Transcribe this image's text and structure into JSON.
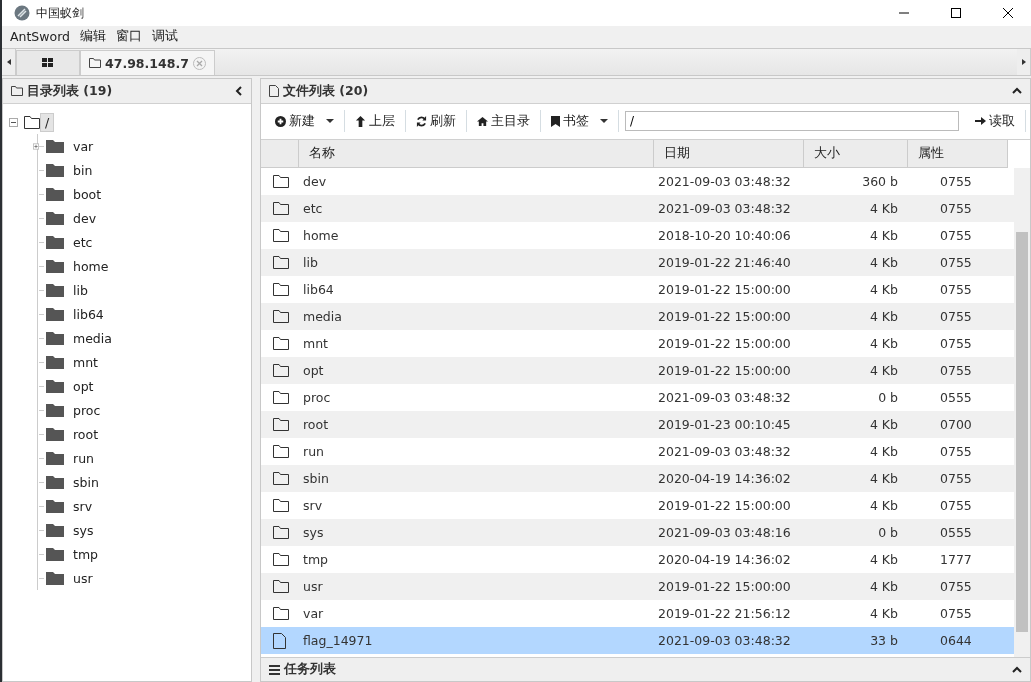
{
  "window": {
    "title": "中国蚁剑"
  },
  "menu": [
    "AntSword",
    "编辑",
    "窗口",
    "调试"
  ],
  "tabs": [
    {
      "kind": "grid",
      "selected": false
    },
    {
      "kind": "folder",
      "label": "47.98.148.7",
      "selected": true
    }
  ],
  "dir_panel": {
    "title": "目录列表 (19)",
    "tree": {
      "name": "/",
      "selected": true,
      "expanded": true,
      "children": [
        {
          "name": "var",
          "expandable": true
        },
        {
          "name": "bin",
          "expandable": false
        },
        {
          "name": "boot",
          "expandable": false
        },
        {
          "name": "dev",
          "expandable": false
        },
        {
          "name": "etc",
          "expandable": false
        },
        {
          "name": "home",
          "expandable": false
        },
        {
          "name": "lib",
          "expandable": false
        },
        {
          "name": "lib64",
          "expandable": false
        },
        {
          "name": "media",
          "expandable": false
        },
        {
          "name": "mnt",
          "expandable": false
        },
        {
          "name": "opt",
          "expandable": false
        },
        {
          "name": "proc",
          "expandable": false
        },
        {
          "name": "root",
          "expandable": false
        },
        {
          "name": "run",
          "expandable": false
        },
        {
          "name": "sbin",
          "expandable": false
        },
        {
          "name": "srv",
          "expandable": false
        },
        {
          "name": "sys",
          "expandable": false
        },
        {
          "name": "tmp",
          "expandable": false
        },
        {
          "name": "usr",
          "expandable": false
        }
      ]
    }
  },
  "file_panel": {
    "title": "文件列表 (20)",
    "toolbar": [
      {
        "kind": "new",
        "label": "新建",
        "dropdown": true
      },
      {
        "kind": "up",
        "label": "上层",
        "dropdown": false
      },
      {
        "kind": "refresh",
        "label": "刷新",
        "dropdown": false
      },
      {
        "kind": "home",
        "label": "主目录",
        "dropdown": false
      },
      {
        "kind": "bookmark",
        "label": "书签",
        "dropdown": true
      }
    ],
    "path": "/",
    "read_button": "读取",
    "columns": [
      "名称",
      "日期",
      "大小",
      "属性"
    ],
    "rows": [
      {
        "kind": "folder",
        "name": "dev",
        "date": "2021-09-03 03:48:32",
        "size": "360 b",
        "attr": "0755",
        "selected": false
      },
      {
        "kind": "folder",
        "name": "etc",
        "date": "2021-09-03 03:48:32",
        "size": "4 Kb",
        "attr": "0755",
        "selected": false
      },
      {
        "kind": "folder",
        "name": "home",
        "date": "2018-10-20 10:40:06",
        "size": "4 Kb",
        "attr": "0755",
        "selected": false
      },
      {
        "kind": "folder",
        "name": "lib",
        "date": "2019-01-22 21:46:40",
        "size": "4 Kb",
        "attr": "0755",
        "selected": false
      },
      {
        "kind": "folder",
        "name": "lib64",
        "date": "2019-01-22 15:00:00",
        "size": "4 Kb",
        "attr": "0755",
        "selected": false
      },
      {
        "kind": "folder",
        "name": "media",
        "date": "2019-01-22 15:00:00",
        "size": "4 Kb",
        "attr": "0755",
        "selected": false
      },
      {
        "kind": "folder",
        "name": "mnt",
        "date": "2019-01-22 15:00:00",
        "size": "4 Kb",
        "attr": "0755",
        "selected": false
      },
      {
        "kind": "folder",
        "name": "opt",
        "date": "2019-01-22 15:00:00",
        "size": "4 Kb",
        "attr": "0755",
        "selected": false
      },
      {
        "kind": "folder",
        "name": "proc",
        "date": "2021-09-03 03:48:32",
        "size": "0 b",
        "attr": "0555",
        "selected": false
      },
      {
        "kind": "folder",
        "name": "root",
        "date": "2019-01-23 00:10:45",
        "size": "4 Kb",
        "attr": "0700",
        "selected": false
      },
      {
        "kind": "folder",
        "name": "run",
        "date": "2021-09-03 03:48:32",
        "size": "4 Kb",
        "attr": "0755",
        "selected": false
      },
      {
        "kind": "folder",
        "name": "sbin",
        "date": "2020-04-19 14:36:02",
        "size": "4 Kb",
        "attr": "0755",
        "selected": false
      },
      {
        "kind": "folder",
        "name": "srv",
        "date": "2019-01-22 15:00:00",
        "size": "4 Kb",
        "attr": "0755",
        "selected": false
      },
      {
        "kind": "folder",
        "name": "sys",
        "date": "2021-09-03 03:48:16",
        "size": "0 b",
        "attr": "0555",
        "selected": false
      },
      {
        "kind": "folder",
        "name": "tmp",
        "date": "2020-04-19 14:36:02",
        "size": "4 Kb",
        "attr": "1777",
        "selected": false
      },
      {
        "kind": "folder",
        "name": "usr",
        "date": "2019-01-22 15:00:00",
        "size": "4 Kb",
        "attr": "0755",
        "selected": false
      },
      {
        "kind": "folder",
        "name": "var",
        "date": "2019-01-22 21:56:12",
        "size": "4 Kb",
        "attr": "0755",
        "selected": false
      },
      {
        "kind": "file",
        "name": "flag_14971",
        "date": "2021-09-03 03:48:32",
        "size": "33 b",
        "attr": "0644",
        "selected": true
      }
    ]
  },
  "task_panel": {
    "title": "任务列表"
  }
}
